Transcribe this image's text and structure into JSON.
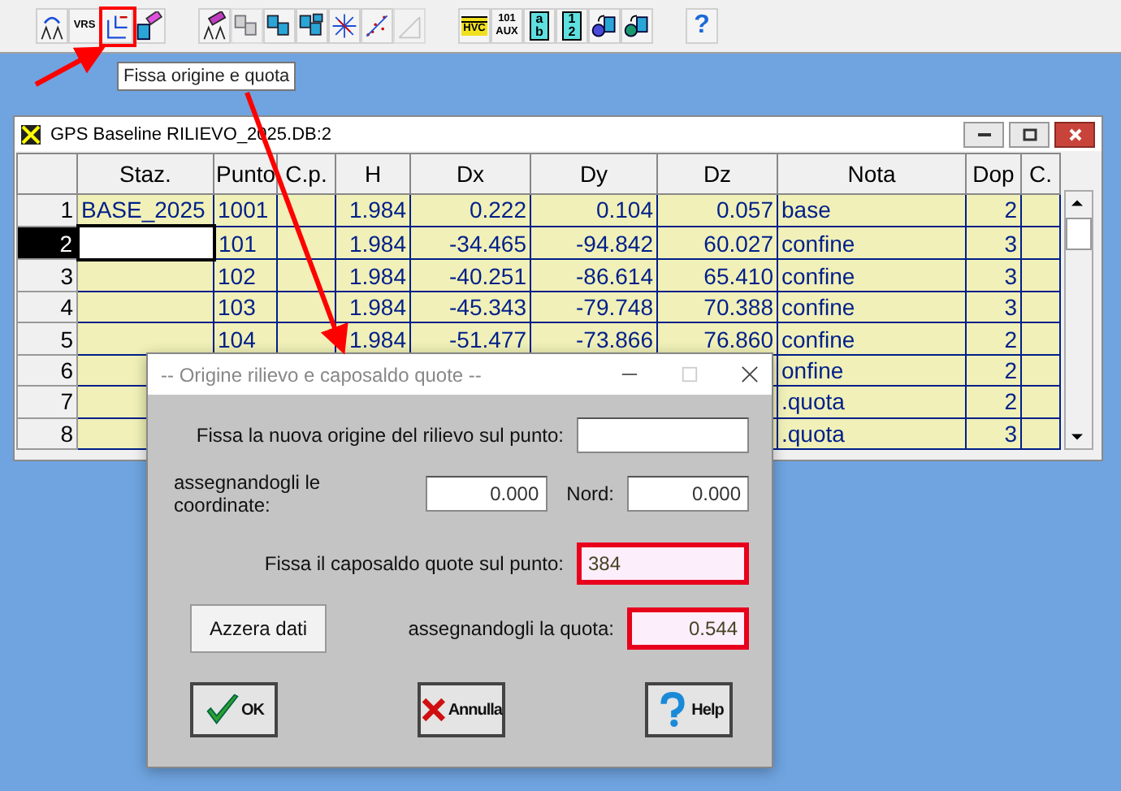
{
  "toolbar": {
    "groups": [
      [
        {
          "kind": "tripod-arrow",
          "disabled": false
        },
        {
          "kind": "tripod",
          "label": "VRS",
          "disabled": false
        },
        {
          "kind": "axes",
          "disabled": false
        },
        {
          "kind": "eraser",
          "disabled": false
        }
      ],
      [
        {
          "kind": "eraser-tripod",
          "disabled": false
        },
        {
          "kind": "pages",
          "disabled": true
        },
        {
          "kind": "pages",
          "disabled": false
        },
        {
          "kind": "pages-four",
          "disabled": false
        },
        {
          "kind": "star",
          "disabled": false
        },
        {
          "kind": "dots",
          "disabled": false
        },
        {
          "kind": "ruler",
          "disabled": true
        }
      ],
      [
        {
          "kind": "grid",
          "label": "HVC",
          "disabled": false
        },
        {
          "kind": "text",
          "label": "101",
          "sublabel": "AUX",
          "disabled": false
        },
        {
          "kind": "page",
          "label": "a",
          "sublabel": "b",
          "disabled": false
        },
        {
          "kind": "page",
          "label": "1",
          "sublabel": "2",
          "disabled": false
        },
        {
          "kind": "gear",
          "disabled": false
        },
        {
          "kind": "globe",
          "disabled": false
        }
      ],
      [
        {
          "kind": "help",
          "label": "?",
          "disabled": false
        }
      ]
    ]
  },
  "tooltip": "Fissa origine e quota",
  "table_window": {
    "title": "GPS Baseline RILIEVO_2025.DB:2",
    "columns": [
      {
        "label": "Staz.",
        "kind": "text"
      },
      {
        "label": "Punto",
        "kind": "text"
      },
      {
        "label": "C.p.",
        "kind": "text"
      },
      {
        "label": "H",
        "kind": "number"
      },
      {
        "label": "Dx",
        "kind": "number"
      },
      {
        "label": "Dy",
        "kind": "number"
      },
      {
        "label": "Dz",
        "kind": "number"
      },
      {
        "label": "Nota",
        "kind": "text"
      },
      {
        "label": "Dop",
        "kind": "number"
      },
      {
        "label": "C.",
        "kind": "text"
      }
    ],
    "rows": [
      {
        "number": "1",
        "selected": false,
        "cells": [
          "BASE_2025",
          "1001",
          null,
          "1.984",
          "0.222",
          "0.104",
          "0.057",
          "base",
          "2",
          null
        ]
      },
      {
        "number": "2",
        "selected": true,
        "cells": [
          null,
          "101",
          null,
          "1.984",
          "-34.465",
          "-94.842",
          "60.027",
          "confine",
          "3",
          null
        ]
      },
      {
        "number": "3",
        "selected": false,
        "cells": [
          null,
          "102",
          null,
          "1.984",
          "-40.251",
          "-86.614",
          "65.410",
          "confine",
          "3",
          null
        ]
      },
      {
        "number": "4",
        "selected": false,
        "cells": [
          null,
          "103",
          null,
          "1.984",
          "-45.343",
          "-79.748",
          "70.388",
          "confine",
          "3",
          null
        ]
      },
      {
        "number": "5",
        "selected": false,
        "cells": [
          null,
          "104",
          null,
          "1.984",
          "-51.477",
          "-73.866",
          "76.860",
          "confine",
          "2",
          null
        ]
      },
      {
        "number": "6",
        "selected": false,
        "cells": [
          null,
          null,
          null,
          null,
          null,
          null,
          null,
          "onfine",
          "2",
          null
        ]
      },
      {
        "number": "7",
        "selected": false,
        "cells": [
          null,
          null,
          null,
          null,
          null,
          null,
          null,
          ".quota",
          "2",
          null
        ]
      },
      {
        "number": "8",
        "selected": false,
        "cells": [
          null,
          null,
          null,
          null,
          null,
          null,
          null,
          ".quota",
          "3",
          null
        ]
      }
    ]
  },
  "dialog": {
    "title": "-- Origine rilievo e caposaldo quote --",
    "origin_label": "Fissa la nuova origine del rilievo sul punto:",
    "coords_label": "assegnandogli le coordinate:",
    "east_value": "0.000",
    "north_label": "Nord:",
    "north_value": "0.000",
    "benchmark_label": "Fissa il caposaldo quote sul punto:",
    "benchmark_value": "384",
    "benchmark_highlighted": true,
    "reset_button": "Azzera dati",
    "height_label": "assegnandogli la quota:",
    "height_value": "0.544",
    "height_highlighted": true,
    "buttons": [
      {
        "kind": "ok",
        "label": "OK"
      },
      {
        "kind": "cancel",
        "label": "Annulla"
      },
      {
        "kind": "help",
        "label": "Help"
      }
    ]
  }
}
